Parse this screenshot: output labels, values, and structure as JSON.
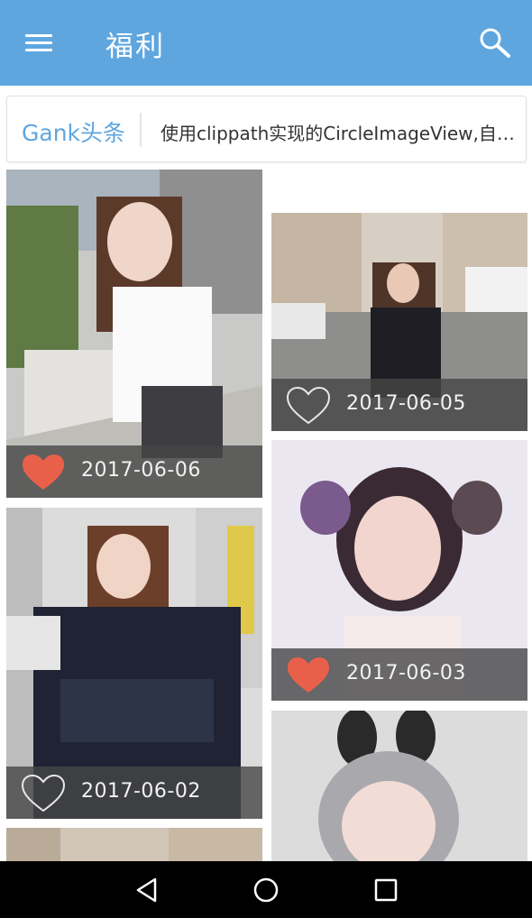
{
  "app_bar": {
    "title": "福利",
    "menu_icon": "menu-icon",
    "search_icon": "search-icon"
  },
  "headline": {
    "label": "Gank头条",
    "text": "使用clippath实现的CircleImageView,自己也可以写实现的..."
  },
  "gallery": {
    "items": [
      {
        "date": "2017-06-06",
        "liked": true
      },
      {
        "date": "2017-06-05",
        "liked": false
      },
      {
        "date": "2017-06-02",
        "liked": false
      },
      {
        "date": "2017-06-03",
        "liked": true
      }
    ]
  },
  "colors": {
    "app_bar": "#5fa6df",
    "accent": "#5fa6df",
    "heart_liked": "#e9604a",
    "date_bar": "#464646"
  },
  "nav_bar": {
    "back_icon": "back-triangle-icon",
    "home_icon": "home-circle-icon",
    "recents_icon": "recents-square-icon"
  }
}
